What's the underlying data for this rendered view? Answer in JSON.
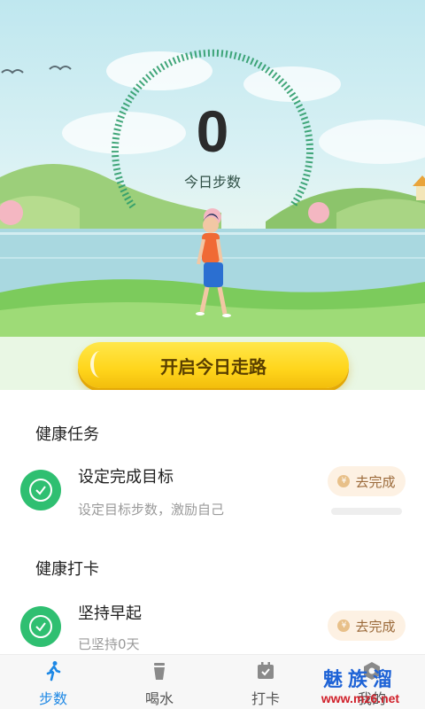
{
  "hero": {
    "step_count": "0",
    "step_label": "今日步数",
    "walk_button": "开启今日走路"
  },
  "sections": {
    "tasks_title": "健康任务",
    "checkin_title": "健康打卡"
  },
  "tasks": [
    {
      "title": "设定完成目标",
      "subtitle": "设定目标步数，激励自己",
      "action": "去完成",
      "progress": 0.0
    }
  ],
  "checkins": [
    {
      "title": "坚持早起",
      "subtitle": "已坚持0天",
      "action": "去完成"
    }
  ],
  "tabbar": {
    "items": [
      {
        "label": "步数",
        "icon": "walk-icon",
        "active": true
      },
      {
        "label": "喝水",
        "icon": "cup-icon",
        "active": false
      },
      {
        "label": "打卡",
        "icon": "calendar-check-icon",
        "active": false
      },
      {
        "label": "我的",
        "icon": "profile-icon",
        "active": false
      }
    ]
  },
  "watermark": {
    "main": "魅族溜",
    "sub": "www.mz6.net"
  },
  "colors": {
    "accent_green": "#2fbf71",
    "tab_active": "#1e88e5",
    "button_yellow": "#ffd51b"
  }
}
